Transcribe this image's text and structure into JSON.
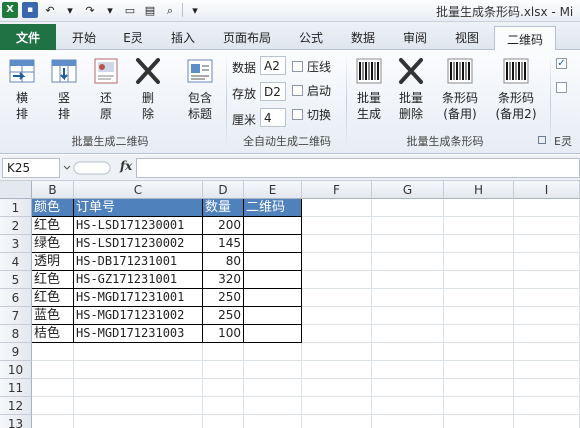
{
  "window": {
    "title": "批量生成条形码.xlsx - Mi"
  },
  "tabs": [
    "文件",
    "开始",
    "E灵",
    "插入",
    "页面布局",
    "公式",
    "数据",
    "审阅",
    "视图",
    "二维码"
  ],
  "ribbon": {
    "group1": {
      "label": "批量生成二维码",
      "buttons": [
        "横\n排",
        "竖\n排",
        "还\n原",
        "删\n除",
        "包含\n标题"
      ]
    },
    "group2": {
      "label": "全自动生成二维码",
      "data_label": "数据",
      "data_value": "A2",
      "store_label": "存放",
      "store_value": "D2",
      "cm_label": "厘米",
      "cm_value": "4",
      "checks": [
        "压线",
        "启动",
        "切换"
      ]
    },
    "group3": {
      "label": "批量生成条形码",
      "buttons": [
        "批量\n生成",
        "批量\n删除",
        "条形码\n(备用)",
        "条形码\n(备用2)"
      ]
    },
    "group4": {
      "label": "E灵"
    }
  },
  "formula_bar": {
    "name_box": "K25",
    "fx": "fx",
    "formula": ""
  },
  "grid": {
    "columns": [
      "B",
      "C",
      "D",
      "E",
      "F",
      "G",
      "H",
      "I"
    ],
    "rows": [
      "1",
      "2",
      "3",
      "4",
      "5",
      "6",
      "7",
      "8",
      "9",
      "10",
      "11",
      "12",
      "13"
    ],
    "header": [
      "颜色",
      "订单号",
      "数量",
      "二维码"
    ],
    "data": [
      [
        "红色",
        "HS-LSD171230001",
        "200",
        ""
      ],
      [
        "绿色",
        "HS-LSD171230002",
        "145",
        ""
      ],
      [
        "透明",
        "HS-DB171231001",
        "80",
        ""
      ],
      [
        "红色",
        "HS-GZ171231001",
        "320",
        ""
      ],
      [
        "红色",
        "HS-MGD171231001",
        "250",
        ""
      ],
      [
        "蓝色",
        "HS-MGD171231002",
        "250",
        ""
      ],
      [
        "桔色",
        "HS-MGD171231003",
        "100",
        ""
      ]
    ]
  }
}
